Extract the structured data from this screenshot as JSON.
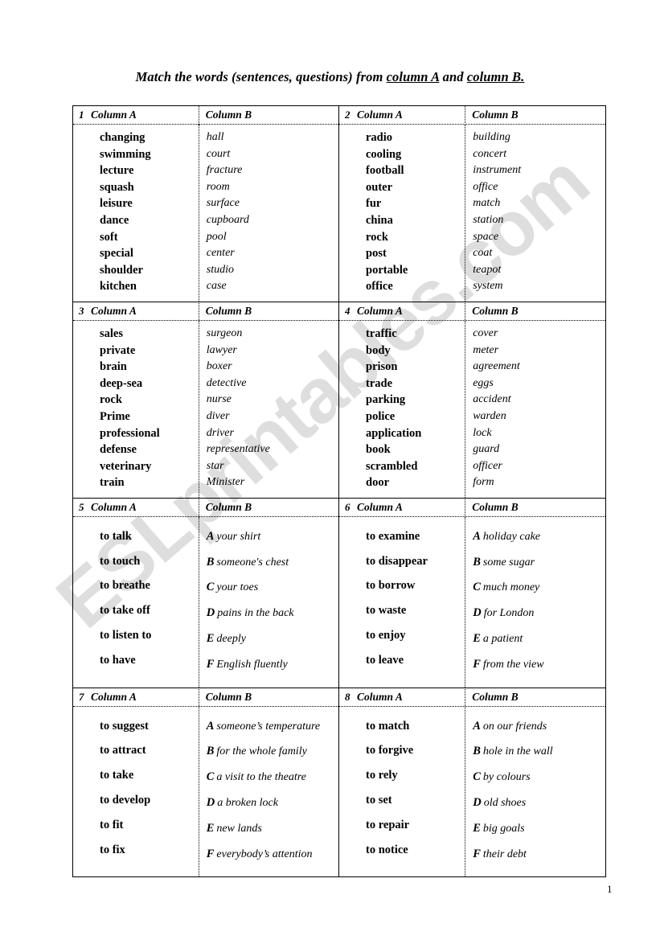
{
  "title": {
    "part1": "Match the words (sentences, questions) from ",
    "link_a": "column A",
    "mid": "  and  ",
    "link_b": "column B."
  },
  "watermark": {
    "text": "ESLprintables.com"
  },
  "page_number": "1",
  "labels": {
    "column_a": "Column A",
    "column_b": "Column B"
  },
  "blocks": [
    {
      "number": "1",
      "col_a_label": "Column A",
      "col_b_label": "Column B",
      "col_a": [
        "changing",
        "swimming",
        "lecture",
        "squash",
        "leisure",
        "dance",
        "soft",
        "special",
        "shoulder",
        "kitchen"
      ],
      "col_b": [
        "hall",
        "court",
        "fracture",
        "room",
        "surface",
        "cupboard",
        "pool",
        "center",
        "studio",
        "case"
      ],
      "lettered": false
    },
    {
      "number": "2",
      "col_a_label": "Column A",
      "col_b_label": "Column B",
      "col_a": [
        "radio",
        "cooling",
        "football",
        "outer",
        "fur",
        "china",
        "rock",
        "post",
        "portable",
        "office"
      ],
      "col_b": [
        "building",
        "concert",
        "instrument",
        "office",
        "match",
        "station",
        "space",
        "coat",
        "teapot",
        "system"
      ],
      "lettered": false
    },
    {
      "number": "3",
      "col_a_label": "Column A",
      "col_b_label": "Column B",
      "col_a": [
        "sales",
        "private",
        "brain",
        "deep-sea",
        "rock",
        "Prime",
        "professional",
        "defense",
        "veterinary",
        " train"
      ],
      "col_b": [
        "surgeon",
        "lawyer",
        "boxer",
        "detective",
        "nurse",
        "diver",
        "driver",
        "representative",
        "star",
        "Minister"
      ],
      "lettered": false
    },
    {
      "number": "4",
      "col_a_label": "Column A",
      "col_b_label": "Column B",
      "col_a": [
        "traffic",
        "body",
        "prison",
        "trade",
        "parking",
        "police",
        "application",
        "book",
        "scrambled",
        "door"
      ],
      "col_b": [
        "cover",
        "meter",
        "agreement",
        "eggs",
        "accident",
        "warden",
        "lock",
        "guard",
        "officer",
        "form"
      ],
      "lettered": false
    },
    {
      "number": "5",
      "col_a_label": "Column A",
      "col_b_label": "Column B",
      "col_a": [
        "to talk",
        "to touch",
        "to breathe",
        "to take off",
        "to listen to",
        "to have"
      ],
      "col_b": [
        "your shirt",
        "someone's chest",
        "your toes",
        "pains in the back",
        "deeply",
        "English fluently"
      ],
      "letters": [
        "A",
        "B",
        "C",
        "D",
        "E",
        "F"
      ],
      "lettered": true
    },
    {
      "number": "6",
      "col_a_label": "Column A",
      "col_b_label": "Column B",
      "col_a": [
        "to examine",
        "to disappear",
        "to borrow",
        "to waste",
        "to enjoy",
        "to leave"
      ],
      "col_b": [
        "holiday cake",
        "some sugar",
        "much money",
        "for London",
        "a patient",
        "from the view"
      ],
      "letters": [
        "A",
        "B",
        "C",
        "D",
        "E",
        "F"
      ],
      "lettered": true
    },
    {
      "number": "7",
      "col_a_label": "Column A",
      "col_b_label": "Column B",
      "col_a": [
        "to suggest",
        "to attract",
        "to take",
        "to develop",
        "to fit",
        "to fix"
      ],
      "col_b": [
        "someone’s temperature",
        "for the whole family",
        "a visit to the theatre",
        "a broken lock",
        "new lands",
        "everybody’s attention"
      ],
      "letters": [
        "A",
        "B",
        "C",
        "D",
        "E",
        "F"
      ],
      "lettered": true
    },
    {
      "number": "8",
      "col_a_label": "Column A",
      "col_b_label": "Column B",
      "col_a": [
        "to match",
        "to forgive",
        "to rely",
        "to set",
        "to repair",
        "to notice"
      ],
      "col_b": [
        "on our friends",
        "hole in the wall",
        "by colours",
        "old shoes",
        "big goals",
        "their debt"
      ],
      "letters": [
        "A",
        "B",
        "C",
        "D",
        "E",
        "F"
      ],
      "lettered": true
    }
  ]
}
